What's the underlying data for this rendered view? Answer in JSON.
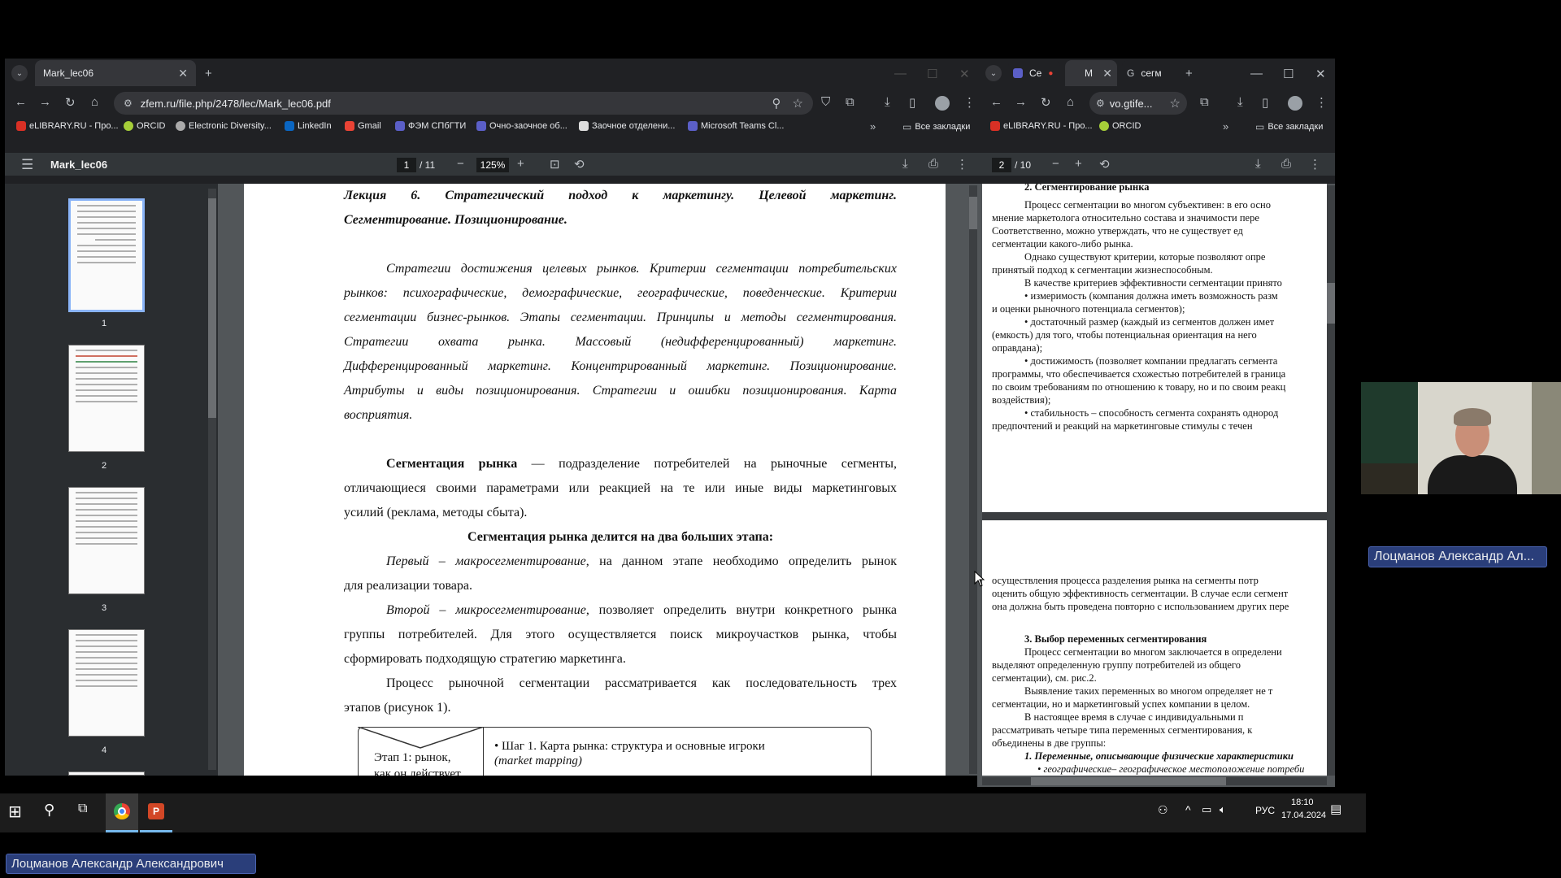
{
  "left_browser": {
    "tab_title": "Mark_lec06",
    "url": "zfem.ru/file.php/2478/lec/Mark_lec06.pdf",
    "bookmarks": [
      "eLIBRARY.RU - Про...",
      "ORCID",
      "Electronic Diversity...",
      "LinkedIn",
      "Gmail",
      "ФЭМ СПбГТИ",
      "Очно-заочное об...",
      "Заочное отделени...",
      "Microsoft Teams Cl..."
    ],
    "all_bookmarks": "Все закладки",
    "pdf": {
      "file_name": "Mark_lec06",
      "page_current": "1",
      "page_total": "/ 11",
      "zoom": "125%",
      "thumb_labels": [
        "1",
        "2",
        "3",
        "4"
      ],
      "title_line1": "Лекция 6. Стратегический подход к маркетингу. Целевой маркетинг.",
      "title_line2": "Сегментирование. Позиционирование.",
      "abstract": [
        "Стратегии достижения целевых рынков. Критерии сегментации потребительских",
        "рынков: психографические, демографические, географические, поведенческие. Критерии",
        "сегментации бизнес-рынков. Этапы сегментации. Принципы и методы сегментирования.",
        "Стратегии охвата рынка. Массовый (недифференцированный) маркетинг.",
        "Дифференцированный маркетинг. Концентрированный маркетинг. Позиционирование.",
        "Атрибуты и виды позиционирования. Стратегии и ошибки позиционирования. Карта",
        "восприятия."
      ],
      "definition_term": "Сегментация рынка",
      "definition_rest": " — подразделение потребителей на рыночные сегменты,",
      "definition_2": "отличающиеся своими параметрами или реакцией на те или иные виды маркетинговых",
      "definition_3": "усилий (реклама, методы сбыта).",
      "stages_heading": "Сегментация рынка делится на два больших этапа:",
      "first_term": "Первый – макросегментирование",
      "first_rest": ", на данном этапе необходимо определить рынок",
      "first_2": "для реализации товара.",
      "second_term": "Второй – микросегментирование",
      "second_rest": ", позволяет определить внутри конкретного рынка",
      "second_2": "группы потребителей. Для этого осуществляется поиск микроучастков рынка, чтобы",
      "second_3": "сформировать подходящую стратегию маркетинга.",
      "process_1": "Процесс рыночной сегментации рассматривается как последовательность трех",
      "process_2": "этапов (рисунок 1).",
      "fig_stage": "Этап 1: рынок,",
      "fig_stage_2": "как он действует",
      "fig_step": "• Шаг 1. Карта рынка: структура и основные игроки",
      "fig_step_2": "(market mapping)"
    }
  },
  "right_browser": {
    "tabs": [
      "Се",
      "М",
      "сегм"
    ],
    "url": "vo.gtife...",
    "bookmarks": [
      "eLIBRARY.RU - Про...",
      "ORCID"
    ],
    "all_bookmarks": "Все закладки",
    "page_current": "2",
    "page_total": "/ 10",
    "lines_top": [
      "2. Сегментирование рынка",
      "Процесс сегментации во многом субъективен: в его осно",
      "мнение маркетолога относительно состава и значимости пере",
      "Соответственно, можно утверждать, что не существует ед",
      "сегментации какого-либо рынка.",
      "Однако существуют критерии, которые позволяют опре",
      "принятый подход к сегментации жизнеспособным.",
      "В качестве критериев эффективности сегментации принято",
      "• измеримость (компания должна иметь возможность разм",
      "и оценки рыночного потенциала сегментов);",
      "• достаточный размер (каждый из сегментов должен имет",
      "(емкость) для того, чтобы потенциальная ориентация на него",
      "оправдана);",
      "• достижимость (позволяет компании предлагать сегмента",
      "программы, что обеспечивается схожестью потребителей в граница",
      "по своим требованиям по отношению к товару, но и по своим реакц",
      "воздействия);",
      "• стабильность – способность сегмента сохранять однород",
      "предпочтений и реакций на маркетинговые стимулы с течен"
    ],
    "lines_bottom": [
      "осуществления процесса разделения рынка на сегменты потр",
      "оценить общую эффективность сегментации. В случае если сегмент",
      "она должна быть проведена повторно с использованием других пере",
      "3. Выбор переменных сегментирования",
      "Процесс сегментации во многом заключается в определени",
      "выделяют определенную группу потребителей из общего",
      "сегментации), см. рис.2.",
      "Выявление таких переменных во многом определяет не т",
      "сегментации, но и маркетинговый успех компании в целом.",
      "В настоящее время в случае с индивидуальными п",
      "рассматривать четыре типа переменных сегментирования, к",
      "объединены в две группы:",
      "1. Переменные, описывающие физические характеристики",
      "• географические– географическое местоположение потреби"
    ]
  },
  "participant": {
    "video_name": "Лоцманов Александр Ал...",
    "full_name": "Лоцманов Александр Александрович"
  },
  "taskbar": {
    "lang": "РУС",
    "time": "18:10",
    "date": "17.04.2024"
  }
}
